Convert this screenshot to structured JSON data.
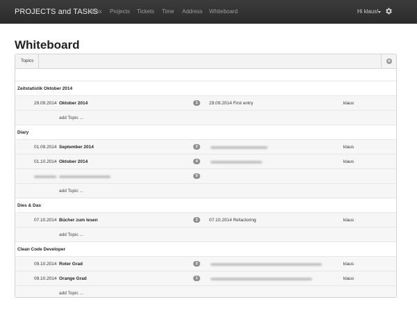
{
  "navbar": {
    "brand": "PROJECTS and TASKS",
    "links": [
      "InBox",
      "Projects",
      "Tickets",
      "Time",
      "Address",
      "Whiteboard"
    ],
    "user_label": "Hi klaus!",
    "settings_icon": "gear-icon"
  },
  "page": {
    "title": "Whiteboard"
  },
  "panel": {
    "tab_label": "Topics",
    "add_icon": "plus-circle-icon"
  },
  "groups": [
    {
      "label": "Zeitstatistik Oktober 2014",
      "items": [
        {
          "date": "29.09.2014",
          "title": "Oktober 2014",
          "count": "1",
          "entry": "29.09.2014 First entry",
          "author": "klaus"
        }
      ],
      "add_label": "add Topic ..."
    },
    {
      "label": "Diary",
      "items": [
        {
          "date": "01.09.2014",
          "title": "September 2014",
          "count": "2",
          "entry": "",
          "author": "klaus"
        },
        {
          "date": "01.10.2014",
          "title": "Oktober 2014",
          "count": "4",
          "entry": "",
          "author": "klaus"
        },
        {
          "date": "",
          "title": "",
          "count": "0",
          "entry": "",
          "author": ""
        }
      ],
      "add_label": "add Topic ..."
    },
    {
      "label": "Dies & Das",
      "items": [
        {
          "date": "07.10.2014",
          "title": "Bücher zum lesen",
          "count": "1",
          "entry": "07.10.2014 Refactoring",
          "author": "klaus"
        }
      ],
      "add_label": "add Topic ..."
    },
    {
      "label": "Clean Code Developer",
      "items": [
        {
          "date": "09.10.2014",
          "title": "Roter Grad",
          "count": "2",
          "entry": "",
          "author": "klaus"
        },
        {
          "date": "09.10.2014",
          "title": "Orange Grad",
          "count": "1",
          "entry": "",
          "author": "klaus"
        }
      ],
      "add_label": "add Topic ..."
    }
  ],
  "colors": {
    "navbar_bg": "#2f2f2f",
    "badge_bg": "#8f8f8f",
    "row_alt_bg": "#f6f6f6"
  }
}
